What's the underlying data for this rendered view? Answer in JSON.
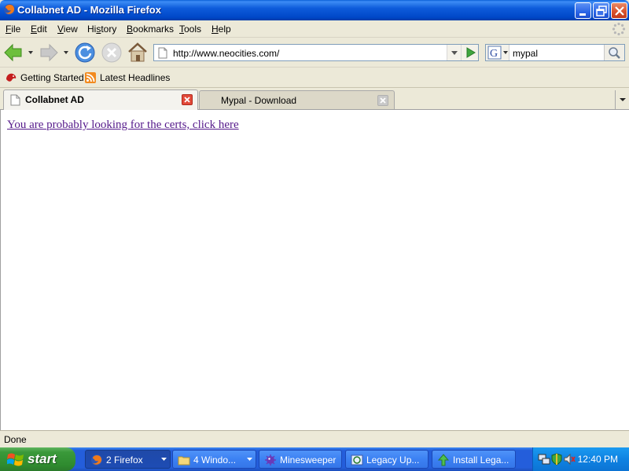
{
  "window": {
    "title": "Collabnet AD - Mozilla Firefox"
  },
  "menubar": {
    "items": [
      {
        "label": "File",
        "accel": "F"
      },
      {
        "label": "Edit",
        "accel": "E"
      },
      {
        "label": "View",
        "accel": "V"
      },
      {
        "label": "History",
        "accel": "s"
      },
      {
        "label": "Bookmarks",
        "accel": "B"
      },
      {
        "label": "Tools",
        "accel": "T"
      },
      {
        "label": "Help",
        "accel": "H"
      }
    ]
  },
  "navbar": {
    "url": "http://www.neocities.com/",
    "search_value": "mypal",
    "search_engine": "G"
  },
  "bookmarks": {
    "items": [
      {
        "label": "Getting Started",
        "icon": "getting-started-icon"
      },
      {
        "label": "Latest Headlines",
        "icon": "rss-feed-icon"
      }
    ]
  },
  "tabs": [
    {
      "label": "Collabnet AD",
      "active": true
    },
    {
      "label": "Mypal - Download",
      "active": false
    }
  ],
  "content": {
    "link_text": "You are probably looking for the certs, click here"
  },
  "status": {
    "text": "Done"
  },
  "taskbar": {
    "start_label": "start",
    "buttons": [
      {
        "label": "2 Firefox",
        "icon": "firefox-icon",
        "has_group_arrow": true
      },
      {
        "label": "4 Windo...",
        "icon": "folder-icon",
        "has_group_arrow": true
      },
      {
        "label": "Minesweeper",
        "icon": "minesweeper-icon"
      },
      {
        "label": "Legacy Up...",
        "icon": "legacy-update-icon"
      },
      {
        "label": "Install Lega...",
        "icon": "install-icon"
      }
    ],
    "clock": "12:40 PM"
  },
  "colors": {
    "titlebar_blue": "#0047C8",
    "link_visited": "#551A8B",
    "taskbar_blue": "#245EDB",
    "start_green": "#3A993A"
  }
}
